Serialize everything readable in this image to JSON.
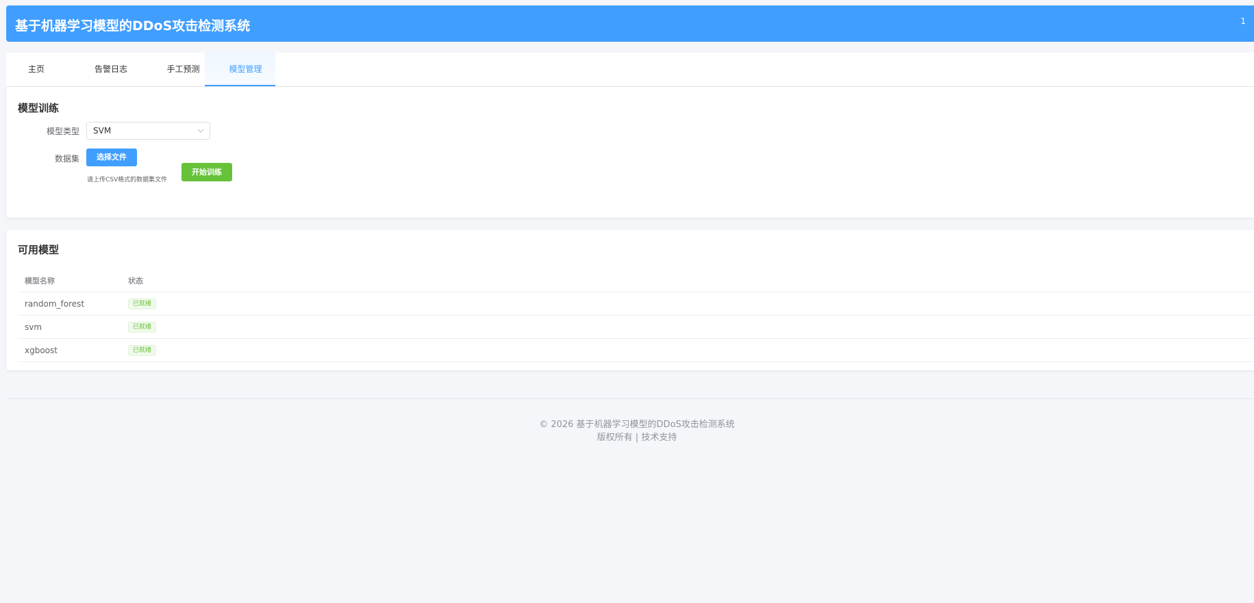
{
  "header": {
    "title": "基于机器学习模型的DDoS攻击检测系统",
    "right_text": "1"
  },
  "tabs": [
    {
      "label": "主页",
      "active": false
    },
    {
      "label": "告警日志",
      "active": false
    },
    {
      "label": "手工预测",
      "active": false
    },
    {
      "label": "模型管理",
      "active": true
    }
  ],
  "training": {
    "title": "模型训练",
    "model_type_label": "模型类型",
    "model_type_value": "SVM",
    "dataset_label": "数据集",
    "choose_file_label": "选择文件",
    "hint": "请上传CSV格式的数据集文件",
    "start_label": "开始训练"
  },
  "models": {
    "title": "可用模型",
    "columns": [
      "模型名称",
      "状态"
    ],
    "rows": [
      {
        "name": "random_forest",
        "status": "已就绪"
      },
      {
        "name": "svm",
        "status": "已就绪"
      },
      {
        "name": "xgboost",
        "status": "已就绪"
      }
    ]
  },
  "footer": {
    "line1": "© 2026 基于机器学习模型的DDoS攻击检测系统",
    "line2": "版权所有 | 技术支持"
  },
  "colors": {
    "primary": "#409eff",
    "success": "#67c23a",
    "background": "#f5f6fa"
  }
}
